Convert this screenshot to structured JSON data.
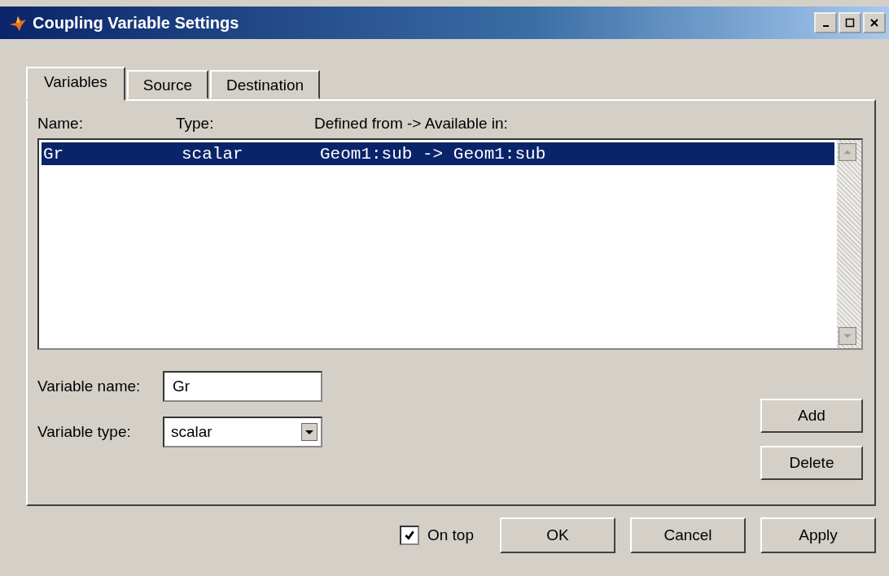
{
  "window": {
    "title": "Coupling Variable Settings"
  },
  "tabs": [
    {
      "label": "Variables",
      "selected": true
    },
    {
      "label": "Source",
      "selected": false
    },
    {
      "label": "Destination",
      "selected": false
    }
  ],
  "list": {
    "columns": [
      "Name:",
      "Type:",
      "Defined from -> Available in:"
    ],
    "rows": [
      {
        "name": "Gr",
        "type": "scalar",
        "defined": "Geom1:sub  -> Geom1:sub",
        "selected": true
      }
    ]
  },
  "fields": [
    {
      "kind": "text",
      "label": "Variable name:",
      "value": "Gr"
    },
    {
      "kind": "select",
      "label": "Variable type:",
      "value": "scalar"
    }
  ],
  "side_buttons": [
    "Add",
    "Delete"
  ],
  "on_top": {
    "label": "On top",
    "checked": true
  },
  "buttons": [
    "OK",
    "Cancel",
    "Apply"
  ]
}
